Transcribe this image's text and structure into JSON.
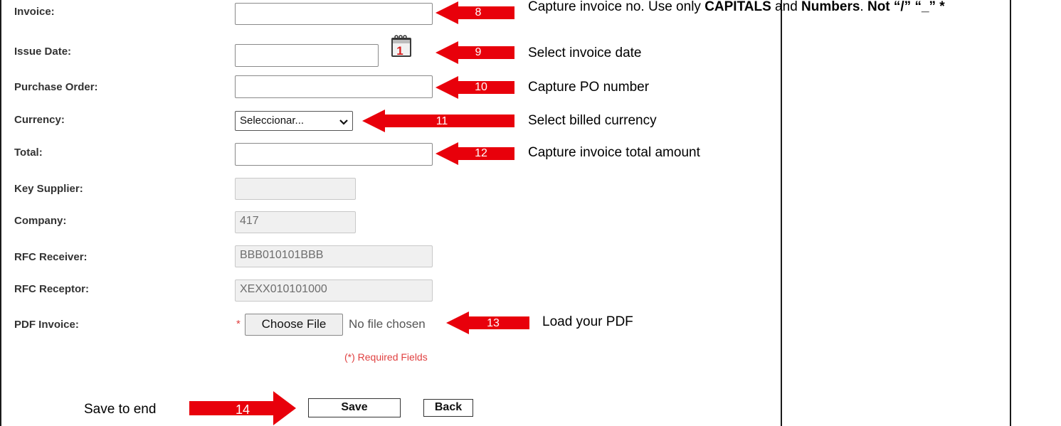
{
  "form": {
    "fields": [
      {
        "label": "Invoice:"
      },
      {
        "label": "Issue Date:"
      },
      {
        "label": "Purchase Order:"
      },
      {
        "label": "Currency:"
      },
      {
        "label": "Total:"
      },
      {
        "label": "Key Supplier:",
        "value": ""
      },
      {
        "label": "Company:",
        "value": "417"
      },
      {
        "label": "RFC Receiver:",
        "value": "BBB010101BBB"
      },
      {
        "label": "RFC Receptor:",
        "value": "XEXX010101000"
      },
      {
        "label": "PDF Invoice:"
      }
    ],
    "currency_select": "Seleccionar...",
    "required_mark": "*",
    "file_button": "Choose File",
    "file_status": "No file chosen",
    "required_note": "(*) Required Fields",
    "calendar_day": "1",
    "save_button": "Save",
    "back_button": "Back"
  },
  "annotations": {
    "steps": [
      {
        "number": "8",
        "text": "Capture invoice no. Use only "
      },
      {
        "number": "9",
        "text": "Select invoice date"
      },
      {
        "number": "10",
        "text": "Capture PO number"
      },
      {
        "number": "11",
        "text": "Select billed currency"
      },
      {
        "number": "12",
        "text": "Capture invoice total amount"
      },
      {
        "number": "13",
        "text": "Load your PDF"
      },
      {
        "number": "14",
        "text": "Save to end"
      }
    ],
    "invoice_note": {
      "bold1": "CAPITALS",
      "mid": " and ",
      "bold2": "Numbers",
      "dot": ". ",
      "bold3": "Not “/” “_” *"
    }
  },
  "colors": {
    "arrow": "#e8000b",
    "required": "#e04040"
  }
}
